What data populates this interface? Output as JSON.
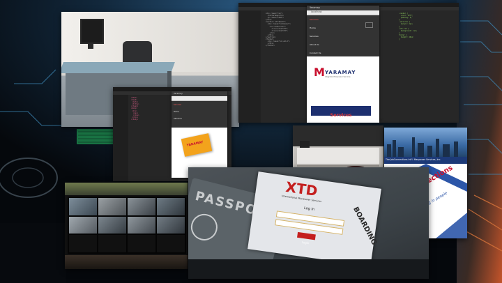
{
  "colors": {
    "accent_red": "#c8102e",
    "brand_navy": "#1d2f6f",
    "code_green": "#8fce5c",
    "code_orange": "#e8914a",
    "code_pink": "#e0608c",
    "code_blue": "#66b0e0",
    "passport_red": "#c41e1e",
    "brochure_blue": "#2c56a8"
  },
  "icons": [
    "menu-icon",
    "close-icon",
    "cctv-camera-feed-icon",
    "logo-m-icon"
  ],
  "main_browser": {
    "tab_label": "Yaramay",
    "url": "localhost",
    "nav_items": [
      "Services",
      "Home",
      "Services",
      "About Us",
      "Contact Us"
    ],
    "logo_mark": "M",
    "brand_name": "YARAMAY",
    "brand_tagline": "Integrated Manpower Services",
    "services_button": "Services"
  },
  "small_browser": {
    "tab_label": "Yaramay",
    "nav_items": [
      "Services",
      "Home",
      "About Us"
    ],
    "card_text": "YARAMAY"
  },
  "passport": {
    "cover_text": "PASSPORT",
    "screen_brand": "XTD",
    "screen_subtitle": "International Manpower Services",
    "login_title": "Log In",
    "login_button": "Login",
    "side_text": "BOARDING"
  },
  "brochure": {
    "company": "The JobConnections Int'l. Manpower Services, Inc.",
    "logo_word": "JobConnections",
    "tagline": "investing in people"
  }
}
